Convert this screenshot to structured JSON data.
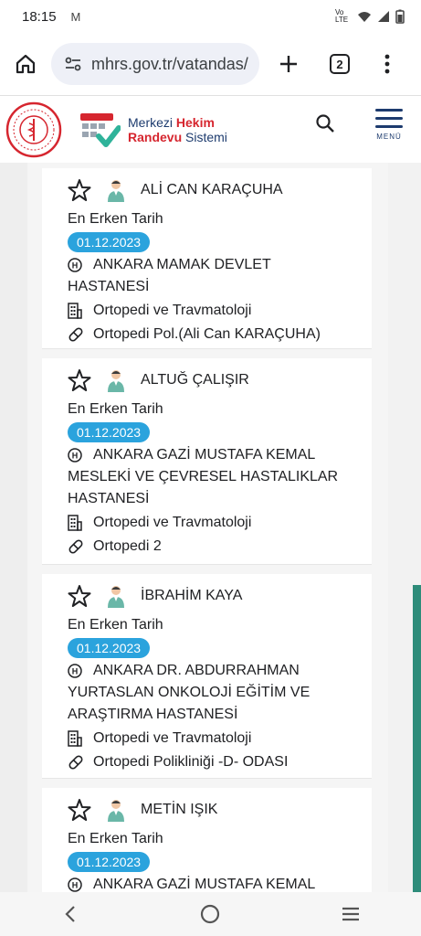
{
  "status": {
    "time": "18:15",
    "gmail_glyph": "M",
    "network": "Vo LTE"
  },
  "browser": {
    "url": "mhrs.gov.tr/vatandas/",
    "tab_count": "2"
  },
  "site": {
    "brand_line1_a": "Merkezi ",
    "brand_line1_b": "Hekim",
    "brand_line2_a": "Randevu",
    "brand_line2_b": " Sistemi",
    "menu_label": "MENÜ"
  },
  "doctors": [
    {
      "name": "ALİ CAN KARAÇUHA",
      "earliest_label": "En Erken Tarih",
      "date": "01.12.2023",
      "hospital_lines": [
        "ANKARA MAMAK DEVLET",
        "HASTANESİ"
      ],
      "department": "Ortopedi ve Travmatoloji",
      "clinic": "Ortopedi Pol.(Ali Can KARAÇUHA)"
    },
    {
      "name": "ALTUĞ ÇALIŞIR",
      "earliest_label": "En Erken Tarih",
      "date": "01.12.2023",
      "hospital_lines": [
        "ANKARA GAZİ MUSTAFA KEMAL",
        "MESLEKİ VE ÇEVRESEL HASTALIKLAR",
        "HASTANESİ"
      ],
      "department": "Ortopedi ve Travmatoloji",
      "clinic": "Ortopedi 2"
    },
    {
      "name": "İBRAHİM KAYA",
      "earliest_label": "En Erken Tarih",
      "date": "01.12.2023",
      "hospital_lines": [
        "ANKARA DR. ABDURRAHMAN",
        "YURTASLAN ONKOLOJİ EĞİTİM VE",
        "ARAŞTIRMA HASTANESİ"
      ],
      "department": "Ortopedi ve Travmatoloji",
      "clinic": "Ortopedi Polikliniği -D- ODASI"
    },
    {
      "name": "METİN IŞIK",
      "earliest_label": "En Erken Tarih",
      "date": "01.12.2023",
      "hospital_lines": [
        "ANKARA GAZİ MUSTAFA KEMAL"
      ],
      "department": "",
      "clinic": ""
    }
  ],
  "colors": {
    "date_badge": "#2ba3dd",
    "brand_navy": "#1d3b6e",
    "brand_red": "#d6262f",
    "scroll_accent": "#2e8c7a"
  }
}
